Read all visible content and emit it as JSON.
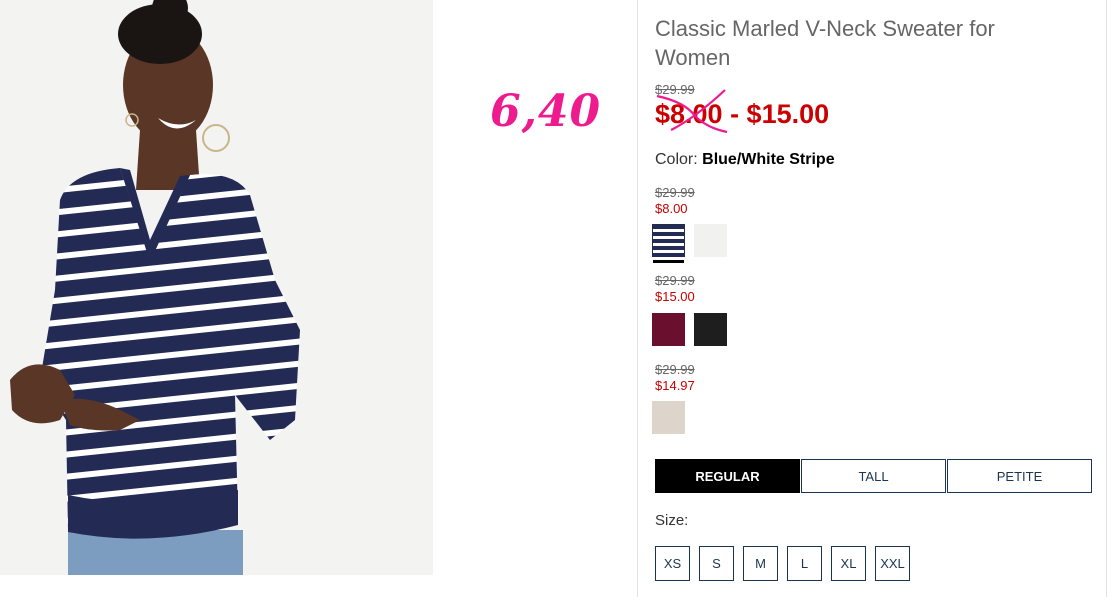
{
  "product": {
    "title": "Classic Marled V-Neck Sweater for Women",
    "original_price": "$29.99",
    "sale_price_range": "$8.00 - $15.00"
  },
  "annotation": {
    "text": "6,40",
    "color": "#ee1b8f"
  },
  "color": {
    "label": "Color:",
    "selected": "Blue/White Stripe"
  },
  "swatch_groups": [
    {
      "original": "$29.99",
      "sale": "$8.00",
      "swatches": [
        "Blue/White Stripe",
        "Cream"
      ]
    },
    {
      "original": "$29.99",
      "sale": "$15.00",
      "swatches": [
        "Burgundy",
        "Black"
      ]
    },
    {
      "original": "$29.99",
      "sale": "$14.97",
      "swatches": [
        "Oatmeal"
      ]
    }
  ],
  "fit_tabs": [
    "REGULAR",
    "TALL",
    "PETITE"
  ],
  "active_fit": "REGULAR",
  "size": {
    "label": "Size:",
    "options": [
      "XS",
      "S",
      "M",
      "L",
      "XL",
      "XXL"
    ]
  },
  "colors": {
    "sale_red": "#cc0000",
    "navy": "#1b3550",
    "annotation_pink": "#ee1b8f"
  }
}
